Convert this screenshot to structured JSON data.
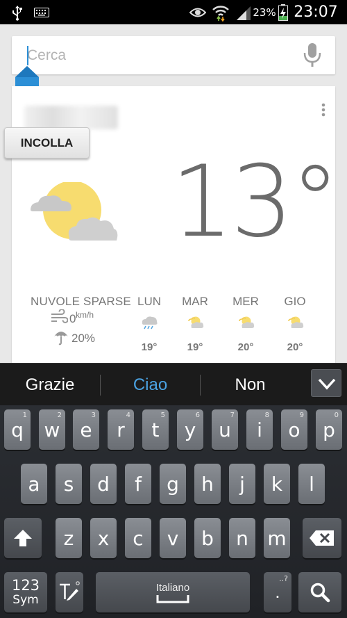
{
  "status_bar": {
    "battery": "23%",
    "time": "23:07",
    "left_icons": [
      "usb-icon",
      "keyboard-icon"
    ],
    "right_icons": [
      "eye-icon",
      "wifi-icon",
      "signal-icon",
      "battery-charging-icon"
    ]
  },
  "search": {
    "placeholder": "Cerca"
  },
  "clipboard": {
    "paste_label": "INCOLLA"
  },
  "weather": {
    "temperature": "13°",
    "condition": "NUVOLE SPARSE",
    "wind_speed": "0",
    "wind_unit": "km/h",
    "precipitation": "20%",
    "forecast": [
      {
        "day": "LUN",
        "temp": "19°",
        "icon": "rain-cloud-icon"
      },
      {
        "day": "MAR",
        "temp": "19°",
        "icon": "partly-cloudy-icon"
      },
      {
        "day": "MER",
        "temp": "20°",
        "icon": "partly-cloudy-icon"
      },
      {
        "day": "GIO",
        "temp": "20°",
        "icon": "partly-cloudy-icon"
      }
    ]
  },
  "suggestions": [
    "Grazie",
    "Ciao",
    "Non"
  ],
  "colors": {
    "suggestion_highlight": "#4ba3e3",
    "accent_blue": "#2c8fd6",
    "sun_yellow": "#f7dc6f",
    "cloud_gray": "#cfcfcf",
    "keyboard_bg": "#24272b",
    "key_face": "#7a7e84"
  },
  "keyboard": {
    "row1": [
      {
        "key": "q",
        "hint": "1"
      },
      {
        "key": "w",
        "hint": "2"
      },
      {
        "key": "e",
        "hint": "3"
      },
      {
        "key": "r",
        "hint": "4"
      },
      {
        "key": "t",
        "hint": "5"
      },
      {
        "key": "y",
        "hint": "6"
      },
      {
        "key": "u",
        "hint": "7"
      },
      {
        "key": "i",
        "hint": "8"
      },
      {
        "key": "o",
        "hint": "9"
      },
      {
        "key": "p",
        "hint": "0"
      }
    ],
    "row2": [
      "a",
      "s",
      "d",
      "f",
      "g",
      "h",
      "j",
      "k",
      "l"
    ],
    "row3": [
      "z",
      "x",
      "c",
      "v",
      "b",
      "n",
      "m"
    ],
    "sym_line1": "123",
    "sym_line2": "Sym",
    "space_label": "Italiano",
    "period": ".",
    "period_hint": "..?"
  }
}
